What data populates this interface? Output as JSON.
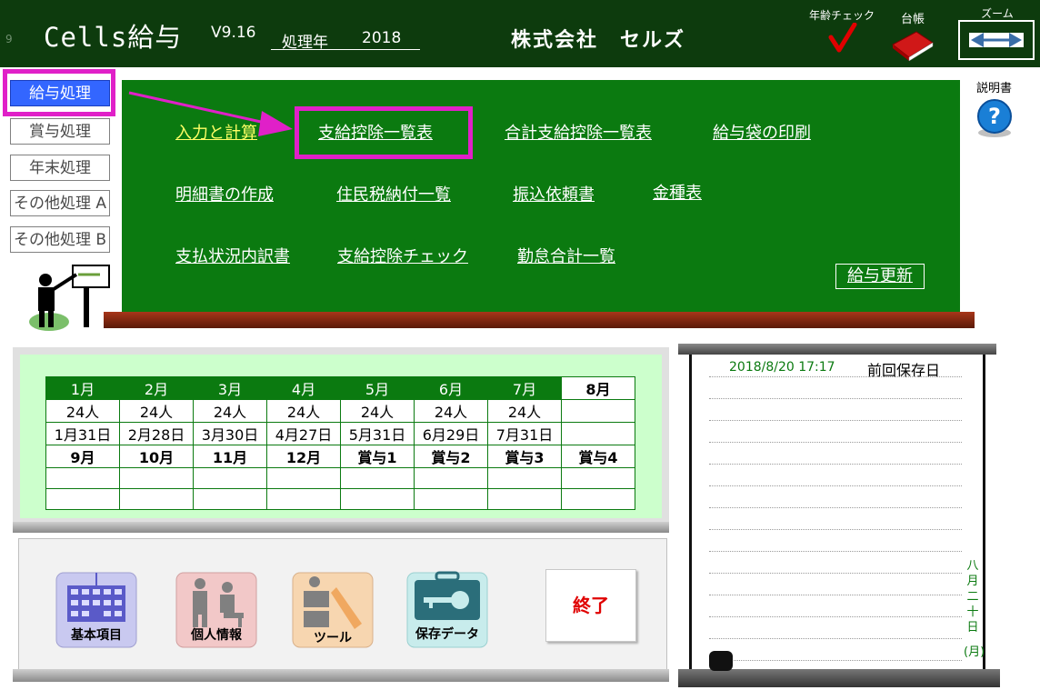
{
  "header": {
    "corner_num": "9",
    "app_title": "Cells給与",
    "version": "V9.16",
    "year_label": "処理年",
    "year_value": "2018",
    "company": "株式会社　セルズ",
    "age_check_label": "年齢チェック",
    "ledger_label": "台帳",
    "zoom_label": "ズーム"
  },
  "help": {
    "label": "説明書"
  },
  "menu": {
    "items": [
      {
        "label": "給与処理"
      },
      {
        "label": "賞与処理"
      },
      {
        "label": "年末処理"
      },
      {
        "label": "その他処理 A"
      },
      {
        "label": "その他処理 B"
      }
    ]
  },
  "board": {
    "links": {
      "input": "入力と計算",
      "pay_list": "支給控除一覧表",
      "total_list": "合計支給控除一覧表",
      "envelope": "給与袋の印刷",
      "statement": "明細書の作成",
      "resident_tax": "住民税納付一覧",
      "transfer": "振込依頼書",
      "denomination": "金種表",
      "payment_status": "支払状況内訳書",
      "pay_check": "支給控除チェック",
      "attendance": "勤怠合計一覧"
    },
    "update_label": "給与更新"
  },
  "calendar": {
    "months_row1": [
      "1月",
      "2月",
      "3月",
      "4月",
      "5月",
      "6月",
      "7月",
      "8月"
    ],
    "people_row1": [
      "24人",
      "24人",
      "24人",
      "24人",
      "24人",
      "24人",
      "24人",
      ""
    ],
    "dates_row1": [
      "1月31日",
      "2月28日",
      "3月30日",
      "4月27日",
      "5月31日",
      "6月29日",
      "7月31日",
      ""
    ],
    "months_row2": [
      "9月",
      "10月",
      "11月",
      "12月",
      "賞与1",
      "賞与2",
      "賞与3",
      "賞与4"
    ]
  },
  "tools": {
    "basic": "基本項目",
    "personal": "個人情報",
    "tool": "ツール",
    "saved": "保存データ",
    "exit": "終了"
  },
  "notes": {
    "save_datetime": "2018/8/20 17:17",
    "save_label": "前回保存日",
    "vertical_date": [
      "八",
      "月",
      "二",
      "十",
      "日",
      "(月)"
    ]
  },
  "colors": {
    "header_bg": "#0d3b0d",
    "board_green": "#0b7a10",
    "highlight_magenta": "#e020c8",
    "selected_blue": "#3366ff",
    "calendar_bg": "#ccffcc",
    "exit_red": "#e00000"
  }
}
